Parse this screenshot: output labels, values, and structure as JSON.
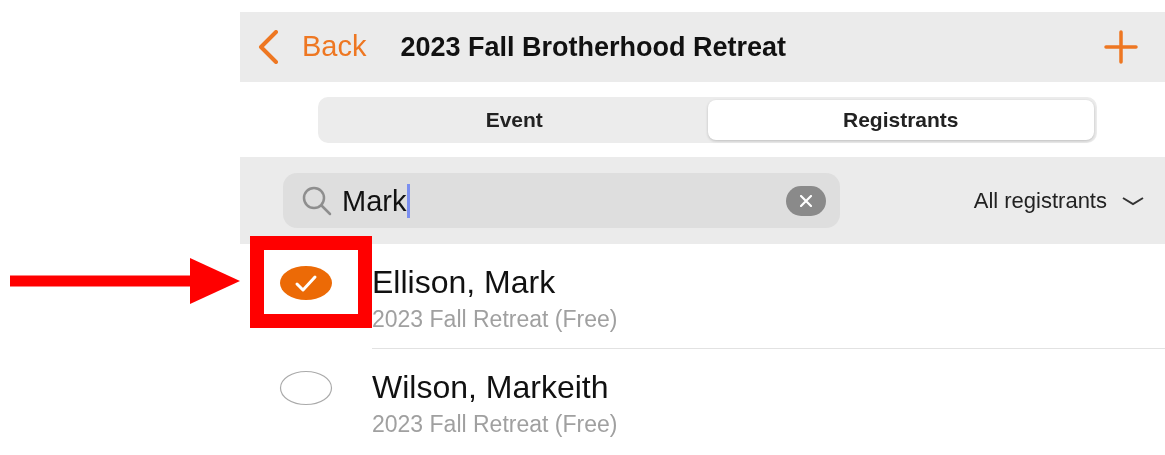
{
  "nav": {
    "back": "Back",
    "title": "2023 Fall Brotherhood Retreat"
  },
  "segments": [
    {
      "label": "Event",
      "selected": false
    },
    {
      "label": "Registrants",
      "selected": true
    }
  ],
  "search": {
    "value": "Mark"
  },
  "filter": {
    "label": "All registrants"
  },
  "registrants": [
    {
      "name": "Ellison, Mark",
      "detail": "2023 Fall Retreat (Free)",
      "checked": true,
      "highlighted": true
    },
    {
      "name": "Wilson, Markeith",
      "detail": "2023 Fall Retreat (Free)",
      "checked": false,
      "highlighted": false
    }
  ]
}
